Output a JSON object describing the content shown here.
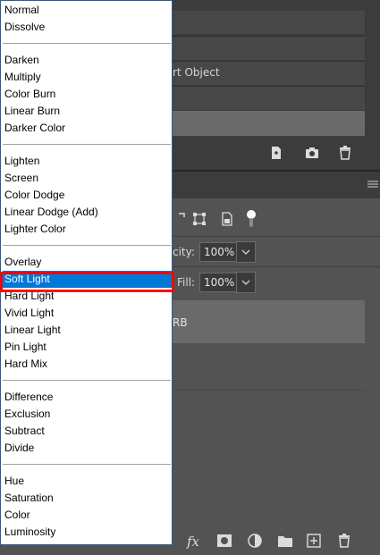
{
  "blend_menu": {
    "groups": [
      [
        "Normal",
        "Dissolve"
      ],
      [
        "Darken",
        "Multiply",
        "Color Burn",
        "Linear Burn",
        "Darker Color"
      ],
      [
        "Lighten",
        "Screen",
        "Color Dodge",
        "Linear Dodge (Add)",
        "Lighter Color"
      ],
      [
        "Overlay",
        "Soft Light",
        "Hard Light",
        "Vivid Light",
        "Linear Light",
        "Pin Light",
        "Hard Mix"
      ],
      [
        "Difference",
        "Exclusion",
        "Subtract",
        "Divide"
      ],
      [
        "Hue",
        "Saturation",
        "Color",
        "Luminosity"
      ]
    ],
    "selected": "Soft Light"
  },
  "panel": {
    "smart_object_label": "rt Object",
    "opacity_label": "city:",
    "opacity_value": "100%",
    "fill_label": "Fill:",
    "fill_value": "100%",
    "layer_label": "RB"
  },
  "icons": {
    "top_toolbar": [
      "new-document-icon",
      "camera-icon",
      "trash-icon"
    ],
    "layer_filters": [
      "transform-icon",
      "artboard-icon",
      "document-icon",
      "toggle-icon"
    ],
    "bottom_toolbar": [
      "fx-icon",
      "mask-icon",
      "adjustment-icon",
      "folder-icon",
      "new-layer-icon",
      "trash-icon"
    ]
  },
  "bottom_fx_label": "fx"
}
